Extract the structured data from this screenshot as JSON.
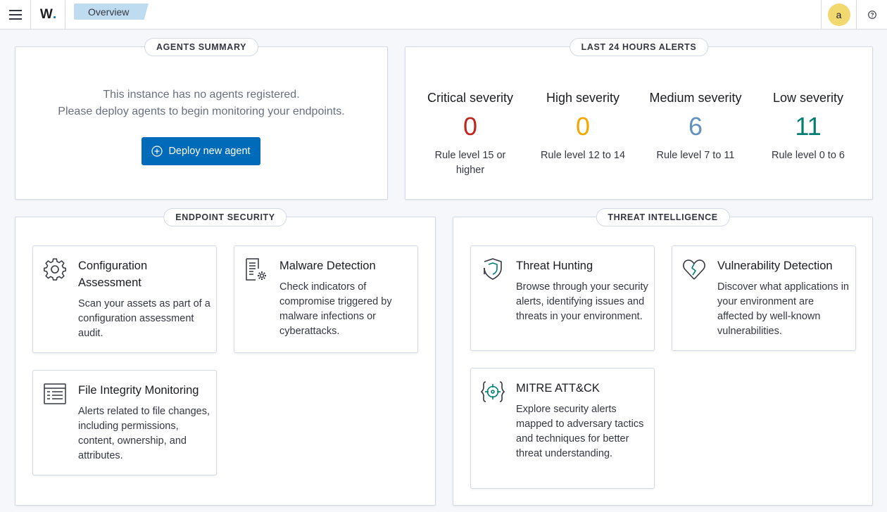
{
  "header": {
    "menu_icon": "hamburger-menu-icon",
    "logo_text": "W",
    "logo_dot": ".",
    "breadcrumb": "Overview",
    "avatar_initial": "a",
    "help_icon": "help-icon"
  },
  "agents_summary": {
    "title": "AGENTS SUMMARY",
    "message_line1": "This instance has no agents registered.",
    "message_line2": "Please deploy agents to begin monitoring your endpoints.",
    "deploy_button": "Deploy new agent",
    "deploy_icon": "plus-in-circle-icon"
  },
  "alerts_24h": {
    "title": "LAST 24 HOURS ALERTS",
    "severities": [
      {
        "label": "Critical severity",
        "value": "0",
        "desc": "Rule level 15 or higher",
        "color": "#bd271e"
      },
      {
        "label": "High severity",
        "value": "0",
        "desc": "Rule level 12 to 14",
        "color": "#f5a700"
      },
      {
        "label": "Medium severity",
        "value": "6",
        "desc": "Rule level 7 to 11",
        "color": "#6092c0"
      },
      {
        "label": "Low severity",
        "value": "11",
        "desc": "Rule level 0 to 6",
        "color": "#017d73"
      }
    ]
  },
  "endpoint_security": {
    "title": "ENDPOINT SECURITY",
    "cards": [
      {
        "title": "Configuration Assessment",
        "desc": "Scan your assets as part of a configuration assessment audit.",
        "icon": "gear-icon"
      },
      {
        "title": "Malware Detection",
        "desc": "Check indicators of compromise triggered by malware infections or cyberattacks.",
        "icon": "document-gear-icon"
      },
      {
        "title": "File Integrity Monitoring",
        "desc": "Alerts related to file changes, including permissions, content, ownership, and attributes.",
        "icon": "list-document-icon"
      }
    ]
  },
  "threat_intelligence": {
    "title": "THREAT INTELLIGENCE",
    "cards": [
      {
        "title": "Threat Hunting",
        "desc": "Browse through your security alerts, identifying issues and threats in your environment.",
        "icon": "shield-icon"
      },
      {
        "title": "Vulnerability Detection",
        "desc": "Discover what applications in your environment are affected by well-known vulnerabilities.",
        "icon": "broken-heart-icon"
      },
      {
        "title": "MITRE ATT&CK",
        "desc": "Explore security alerts mapped to adversary tactics and techniques for better threat understanding.",
        "icon": "crosshair-icon"
      }
    ]
  },
  "colors": {
    "accent": "#006bb8",
    "icon": "#343741",
    "icon_accent": "#017d73"
  }
}
